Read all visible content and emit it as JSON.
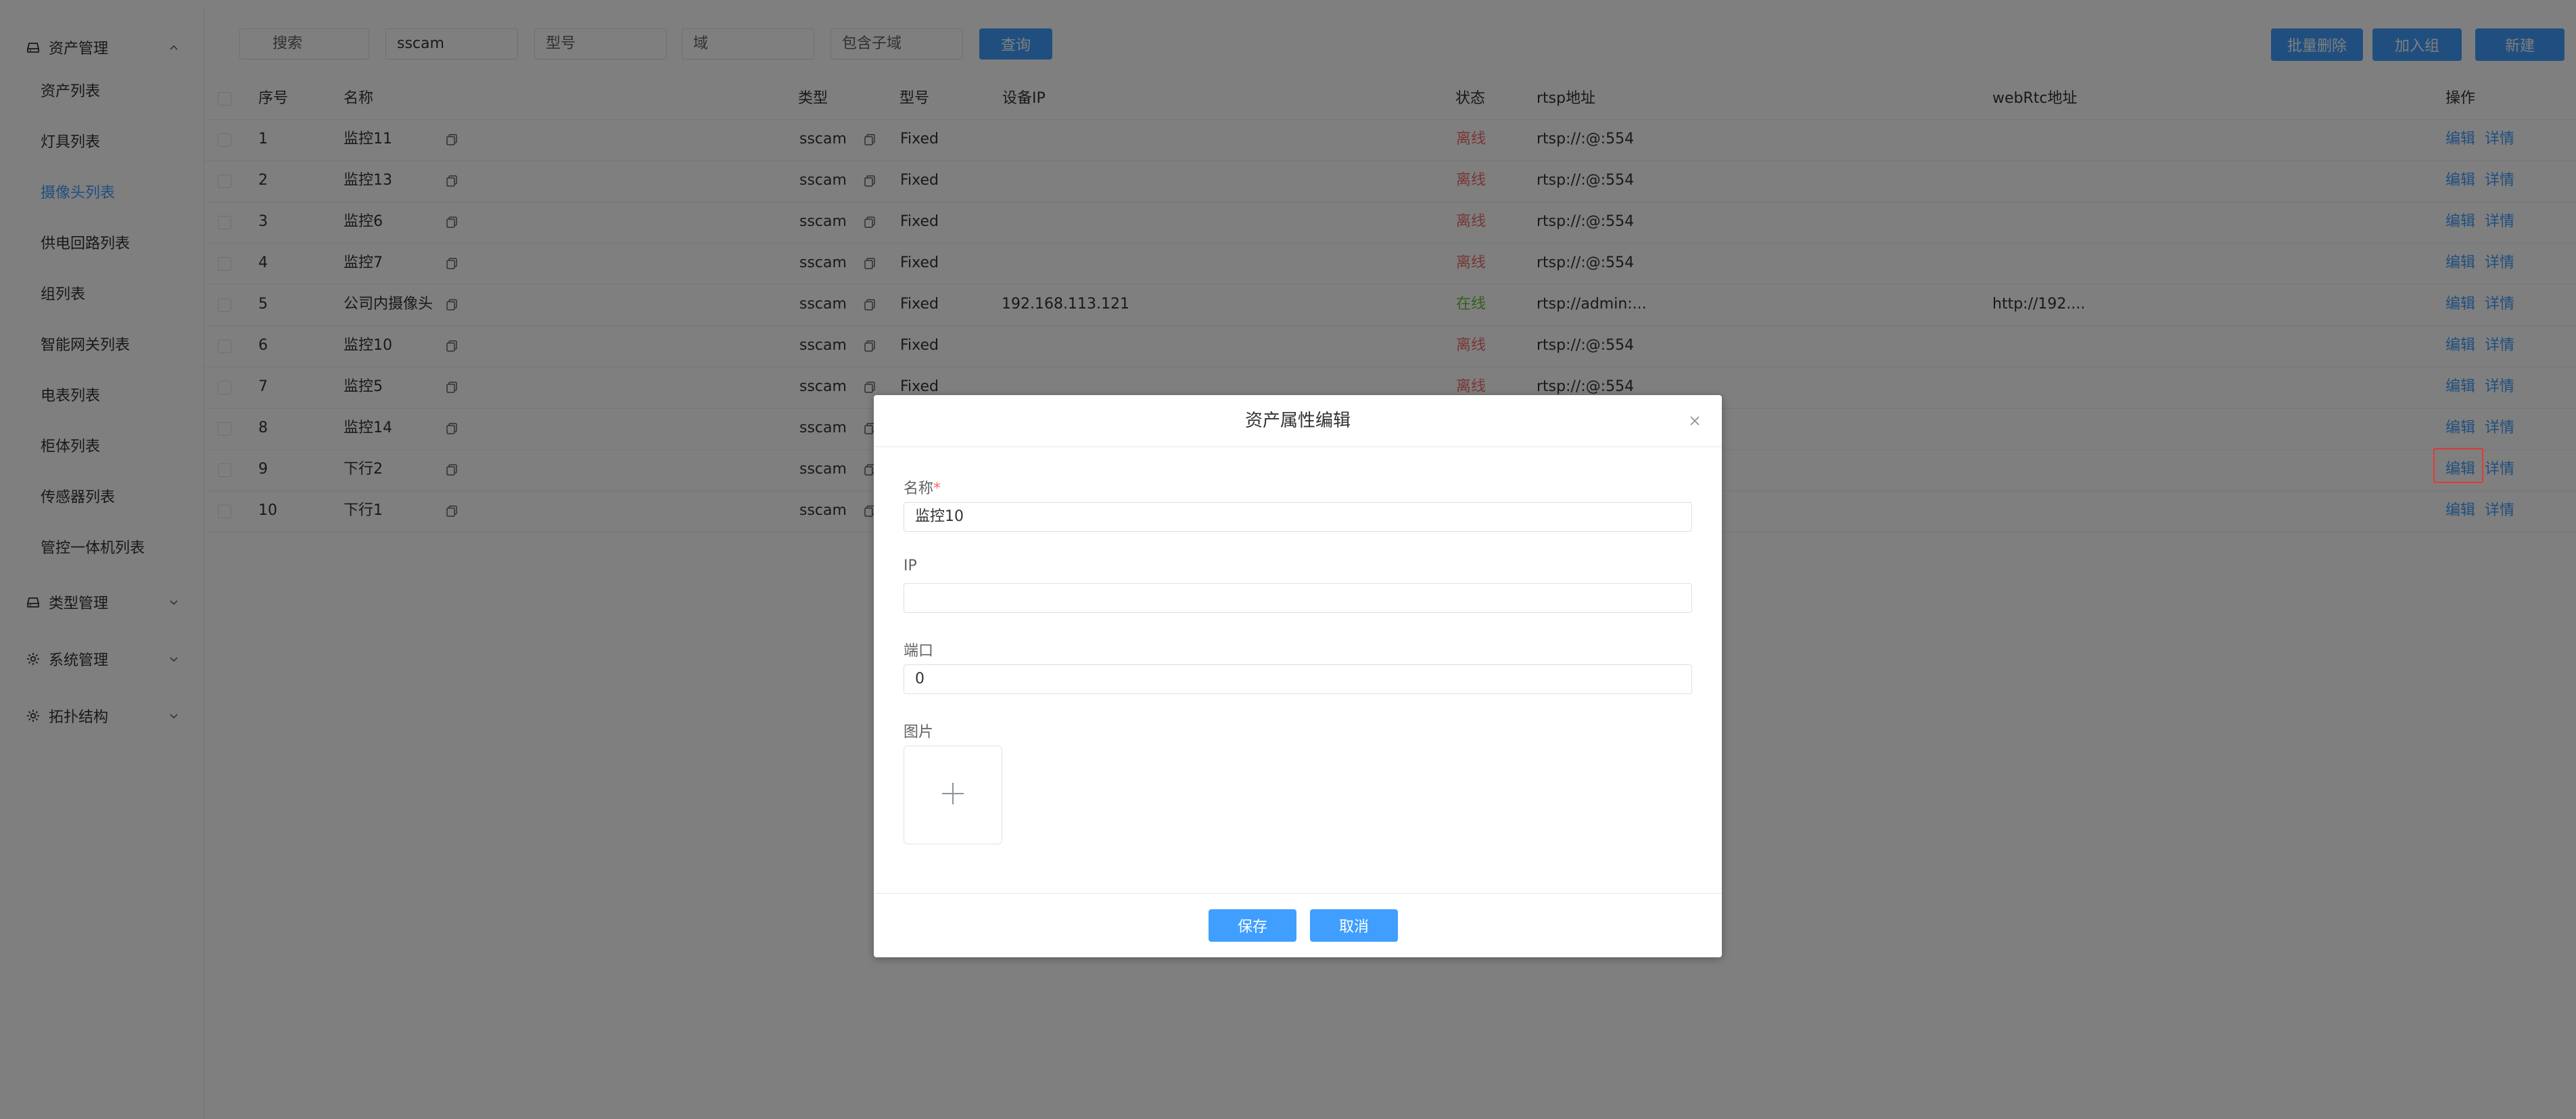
{
  "sidebar": {
    "asset_group": "资产管理",
    "items": [
      {
        "label": "资产列表"
      },
      {
        "label": "灯具列表"
      },
      {
        "label": "摄像头列表"
      },
      {
        "label": "供电回路列表"
      },
      {
        "label": "组列表"
      },
      {
        "label": "智能网关列表"
      },
      {
        "label": "电表列表"
      },
      {
        "label": "柜体列表"
      },
      {
        "label": "传感器列表"
      },
      {
        "label": "管控一体机列表"
      }
    ],
    "type_group": "类型管理",
    "system_group": "系统管理",
    "topology_group": "拓扑结构"
  },
  "filters": {
    "search_placeholder": "搜索",
    "type_value": "sscam",
    "model_placeholder": "型号",
    "domain_placeholder": "域",
    "subdomain_placeholder": "包含子域",
    "query_label": "查询"
  },
  "toolbar": {
    "batch_delete": "批量删除",
    "add_to_group": "加入组",
    "new": "新建"
  },
  "table": {
    "headers": {
      "index": "序号",
      "name": "名称",
      "type": "类型",
      "model": "型号",
      "ip": "设备IP",
      "status": "状态",
      "rtsp": "rtsp地址",
      "webrtc": "webRtc地址",
      "action": "操作"
    },
    "edit_label": "编辑",
    "detail_label": "详情",
    "rows": [
      {
        "index": "1",
        "name": "监控11",
        "type": "sscam",
        "model": "Fixed",
        "ip": "",
        "status": "离线",
        "rtsp": "rtsp://:@:554",
        "webrtc": ""
      },
      {
        "index": "2",
        "name": "监控13",
        "type": "sscam",
        "model": "Fixed",
        "ip": "",
        "status": "离线",
        "rtsp": "rtsp://:@:554",
        "webrtc": ""
      },
      {
        "index": "3",
        "name": "监控6",
        "type": "sscam",
        "model": "Fixed",
        "ip": "",
        "status": "离线",
        "rtsp": "rtsp://:@:554",
        "webrtc": ""
      },
      {
        "index": "4",
        "name": "监控7",
        "type": "sscam",
        "model": "Fixed",
        "ip": "",
        "status": "离线",
        "rtsp": "rtsp://:@:554",
        "webrtc": ""
      },
      {
        "index": "5",
        "name": "公司内摄像头",
        "type": "sscam",
        "model": "Fixed",
        "ip": "192.168.113.121",
        "status": "在线",
        "rtsp": "rtsp://admin:...",
        "webrtc": "http://192...."
      },
      {
        "index": "6",
        "name": "监控10",
        "type": "sscam",
        "model": "Fixed",
        "ip": "",
        "status": "离线",
        "rtsp": "rtsp://:@:554",
        "webrtc": ""
      },
      {
        "index": "7",
        "name": "监控5",
        "type": "sscam",
        "model": "Fixed",
        "ip": "",
        "status": "离线",
        "rtsp": "rtsp://:@:554",
        "webrtc": ""
      },
      {
        "index": "8",
        "name": "监控14",
        "type": "sscam",
        "model": "",
        "ip": "",
        "status": "",
        "rtsp": "",
        "webrtc": ""
      },
      {
        "index": "9",
        "name": "下行2",
        "type": "sscam",
        "model": "",
        "ip": "",
        "status": "",
        "rtsp": "",
        "webrtc": ""
      },
      {
        "index": "10",
        "name": "下行1",
        "type": "sscam",
        "model": "",
        "ip": "",
        "status": "",
        "rtsp": "",
        "webrtc": ""
      }
    ]
  },
  "dialog": {
    "title": "资产属性编辑",
    "name_label": "名称",
    "required_mark": "*",
    "name_value": "监控10",
    "ip_label": "IP",
    "ip_value": "",
    "port_label": "端口",
    "port_value": "0",
    "image_label": "图片",
    "save_label": "保存",
    "cancel_label": "取消"
  },
  "colors": {
    "accent": "#409eff",
    "offline": "#f56c6c",
    "online": "#67c23a",
    "highlight": "#e53935"
  }
}
